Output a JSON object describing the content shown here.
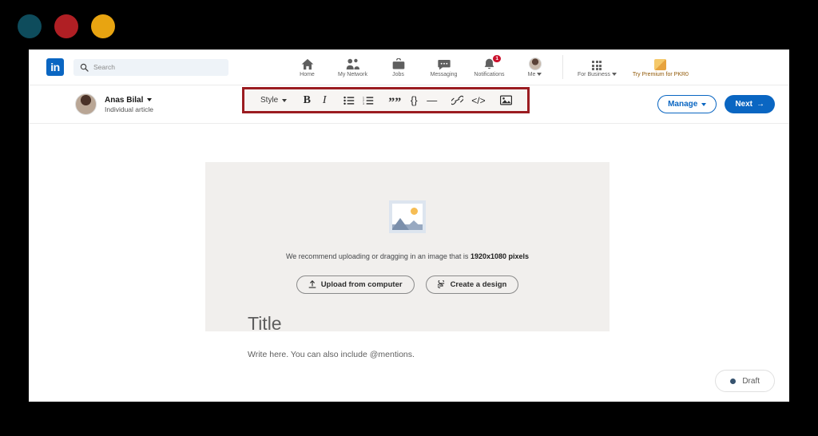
{
  "window": {
    "dots": [
      {
        "name": "dot-teal",
        "color": "#0e4c5c"
      },
      {
        "name": "dot-red",
        "color": "#b01f24"
      },
      {
        "name": "dot-amber",
        "color": "#e8a411"
      }
    ]
  },
  "globalnav": {
    "logo_text": "in",
    "search_placeholder": "Search",
    "search_icon": "search-icon",
    "items": [
      {
        "label": "Home",
        "icon": "home-icon"
      },
      {
        "label": "My Network",
        "icon": "people-icon"
      },
      {
        "label": "Jobs",
        "icon": "briefcase-icon"
      },
      {
        "label": "Messaging",
        "icon": "chat-bubble-icon"
      },
      {
        "label": "Notifications",
        "icon": "bell-icon",
        "badge": "1"
      },
      {
        "label": "Me",
        "icon": "avatar-icon",
        "caret": true
      }
    ],
    "business": {
      "label": "For Business",
      "icon": "grid-icon",
      "caret": true
    },
    "premium": {
      "label": "Try Premium for PKR0",
      "icon": "premium-square-icon"
    }
  },
  "editor": {
    "author": {
      "name": "Anas Bilal",
      "subtitle": "Individual article",
      "avatar": "author-avatar"
    },
    "toolbar": {
      "highlight_color": "#9b1c21",
      "style_label": "Style",
      "buttons": [
        {
          "name": "bold-button",
          "glyph": "B"
        },
        {
          "name": "italic-button",
          "glyph": "I"
        },
        {
          "name": "bulleted-list-button",
          "glyph": "bulleted-list-icon"
        },
        {
          "name": "numbered-list-button",
          "glyph": "numbered-list-icon"
        },
        {
          "name": "quote-button",
          "glyph": "””"
        },
        {
          "name": "code-block-button",
          "glyph": "{}"
        },
        {
          "name": "divider-button",
          "glyph": "—"
        },
        {
          "name": "link-button",
          "glyph": "link-icon"
        },
        {
          "name": "embed-button",
          "glyph": "</>"
        },
        {
          "name": "insert-image-button",
          "glyph": "image-icon"
        }
      ]
    },
    "actions": {
      "manage_label": "Manage",
      "next_label": "Next",
      "next_arrow": "→"
    }
  },
  "canvas": {
    "cover": {
      "placeholder_icon": "image-placeholder-icon",
      "hint_prefix": "We recommend uploading or dragging in an image that is ",
      "hint_strong": "1920x1080 pixels",
      "upload_label": "Upload from computer",
      "upload_icon": "upload-icon",
      "design_label": "Create a design",
      "design_icon": "design-icon"
    },
    "title_placeholder": "Title",
    "body_placeholder": "Write here. You can also include @mentions.",
    "status": {
      "label": "Draft",
      "dot_color": "#36526e"
    }
  }
}
